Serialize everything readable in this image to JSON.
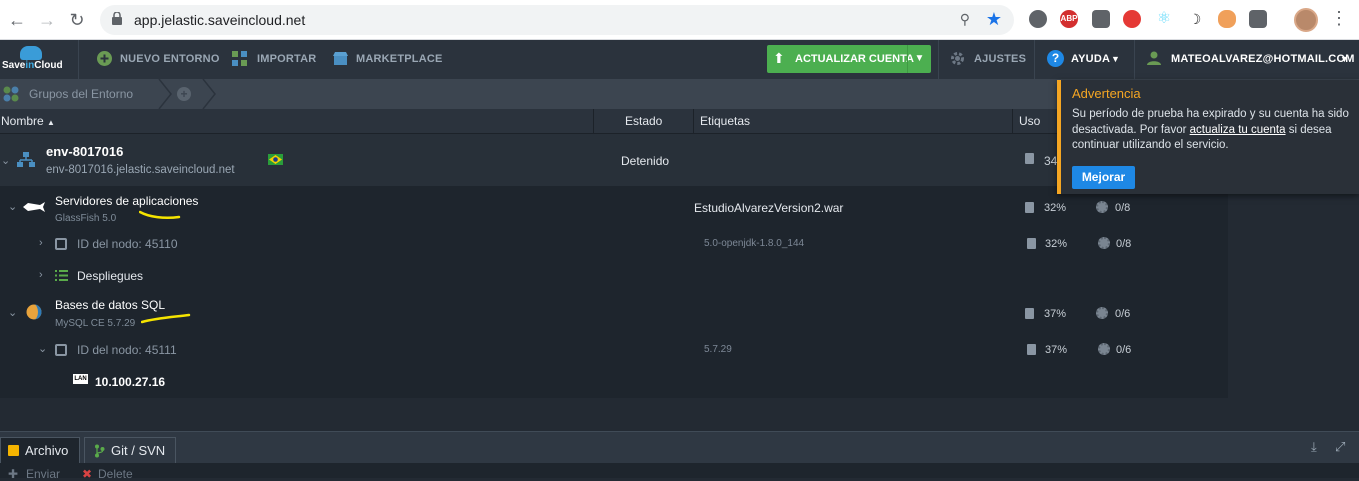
{
  "browser": {
    "url": "app.jelastic.saveincloud.net"
  },
  "toolbar": {
    "logo_text_a": "Save",
    "logo_text_b": "in",
    "logo_text_c": "Cloud",
    "new_env": "NUEVO ENTORNO",
    "import": "IMPORTAR",
    "marketplace": "MARKETPLACE",
    "upgrade": "ACTUALIZAR CUENTA",
    "settings": "AJUSTES",
    "help": "AYUDA",
    "user": "MATEOALVAREZ@HOTMAIL.COM"
  },
  "groups": {
    "label": "Grupos del Entorno"
  },
  "columns": {
    "name": "Nombre",
    "state": "Estado",
    "tags": "Etiquetas",
    "usage": "Uso"
  },
  "environment": {
    "name": "env-8017016",
    "domain": "env-8017016.jelastic.saveincloud.net",
    "state": "Detenido",
    "usage": "34"
  },
  "app_servers": {
    "title": "Servidores de aplicaciones",
    "subtitle": "GlassFish 5.0",
    "tag": "EstudioAlvarezVersion2.war",
    "usage": "32%",
    "cloudlets": "0/8",
    "node_label": "ID del nodo: 45110",
    "node_tag": "5.0-openjdk-1.8.0_144",
    "node_usage": "32%",
    "node_cloudlets": "0/8",
    "deployments": "Despliegues"
  },
  "sql": {
    "title": "Bases de datos SQL",
    "subtitle": "MySQL CE 5.7.29",
    "usage": "37%",
    "cloudlets": "0/6",
    "node_label": "ID del nodo: 45111",
    "node_tag": "5.7.29",
    "node_usage": "37%",
    "node_cloudlets": "0/6",
    "ip": "10.100.27.16",
    "ip_badge": "LAN"
  },
  "warning": {
    "title": "Advertencia",
    "msg_before": "Su período de prueba ha expirado y su cuenta ha sido desactivada. Por favor ",
    "msg_link": "actualiza tu cuenta",
    "msg_after": " si desea continuar utilizando el servicio.",
    "button": "Mejorar"
  },
  "bottom": {
    "tab_file": "Archivo",
    "tab_git": "Git / SVN",
    "action_1": "Enviar",
    "action_2": "Delete"
  },
  "colors": {
    "accent_green": "#4caf50",
    "accent_blue": "#1e88e5",
    "warning_orange": "#f5a623"
  }
}
